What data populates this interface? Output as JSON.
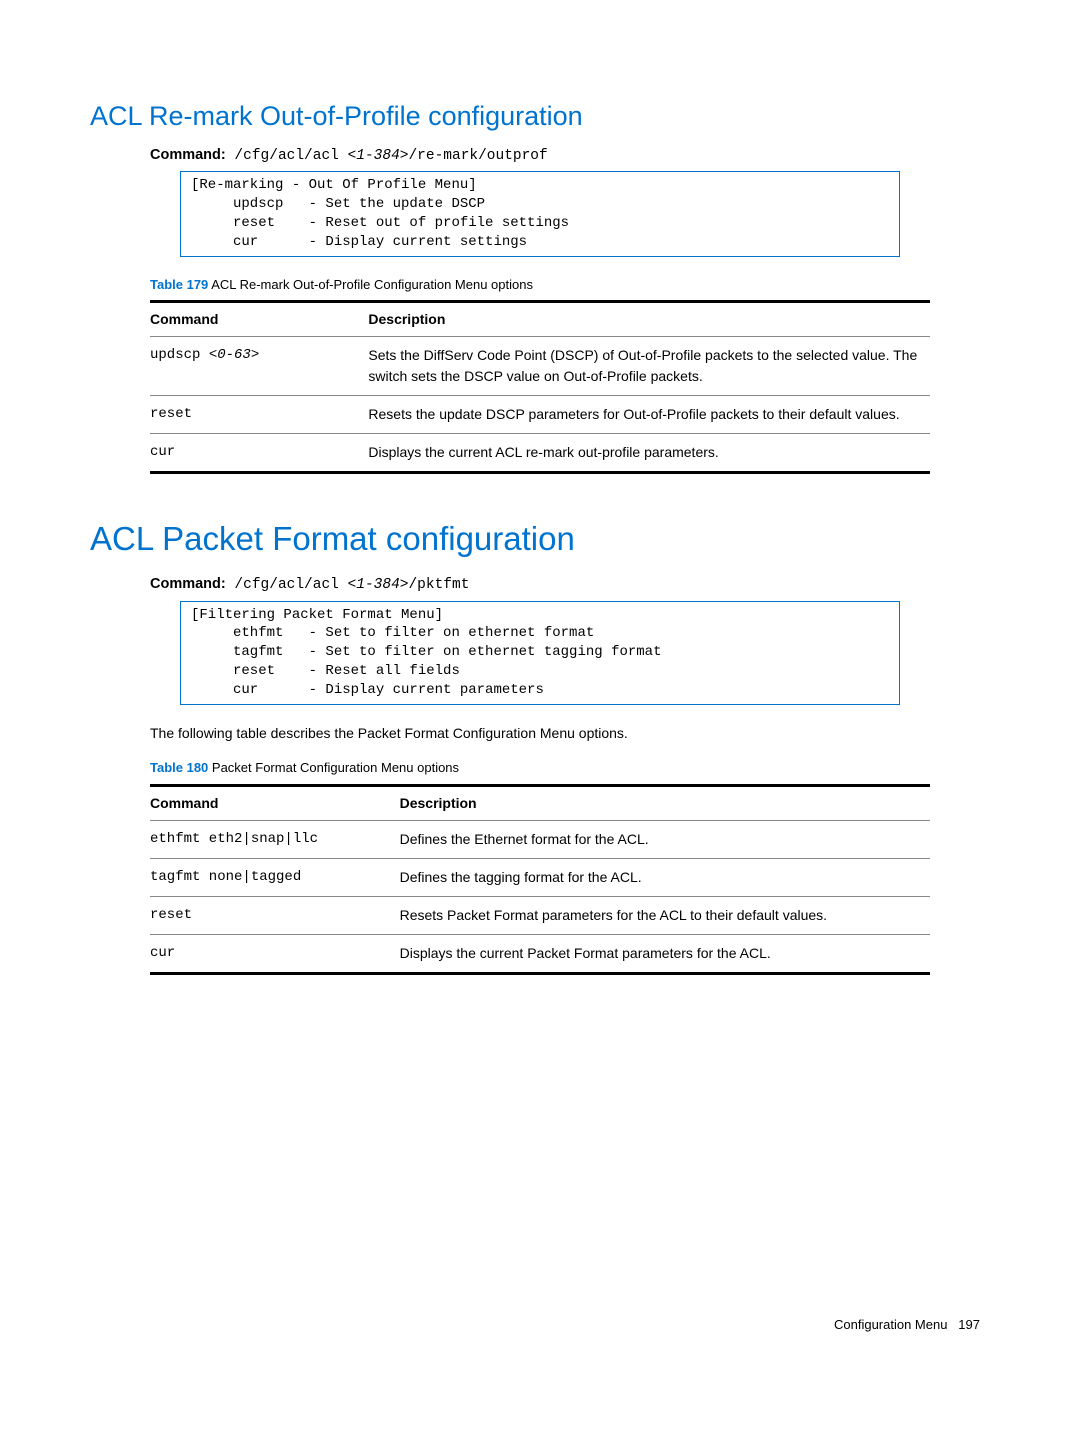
{
  "section1": {
    "heading": "ACL Re-mark Out-of-Profile configuration",
    "command_label": "Command:",
    "command_prefix": " /cfg/acl/acl ",
    "command_arg": "<1-384>",
    "command_suffix": "/re-mark/outprof",
    "code": "[Re-marking - Out Of Profile Menu]\n     updscp   - Set the update DSCP\n     reset    - Reset out of profile settings\n     cur      - Display current settings",
    "table_label": "Table 179",
    "table_caption": "  ACL Re-mark Out-of-Profile Configuration Menu options",
    "th1": "Command",
    "th2": "Description",
    "rows": [
      {
        "cmd_pre": "updscp ",
        "cmd_arg": "<0-63>",
        "desc": "Sets the DiffServ Code Point (DSCP) of Out-of-Profile packets to the selected value. The switch sets the DSCP value on Out-of-Profile packets."
      },
      {
        "cmd_pre": "reset",
        "cmd_arg": "",
        "desc": "Resets the update DSCP parameters for Out-of-Profile packets to their default values."
      },
      {
        "cmd_pre": "cur",
        "cmd_arg": "",
        "desc": "Displays the current ACL re-mark out-profile parameters."
      }
    ]
  },
  "section2": {
    "heading": "ACL Packet Format configuration",
    "command_label": "Command:",
    "command_prefix": " /cfg/acl/acl ",
    "command_arg": "<1-384>",
    "command_suffix": "/pktfmt",
    "code": "[Filtering Packet Format Menu]\n     ethfmt   - Set to filter on ethernet format\n     tagfmt   - Set to filter on ethernet tagging format\n     reset    - Reset all fields\n     cur      - Display current parameters",
    "intro": "The following table describes the Packet Format Configuration Menu options.",
    "table_label": "Table 180",
    "table_caption": "  Packet Format Configuration Menu options",
    "th1": "Command",
    "th2": "Description",
    "rows": [
      {
        "cmd": "ethfmt eth2|snap|llc",
        "desc": "Defines the Ethernet format for the ACL."
      },
      {
        "cmd": "tagfmt none|tagged",
        "desc": "Defines the tagging format for the ACL."
      },
      {
        "cmd": "reset",
        "desc": "Resets Packet Format parameters for the ACL to their default values."
      },
      {
        "cmd": "cur",
        "desc": "Displays the current Packet Format parameters for the ACL."
      }
    ]
  },
  "footer": {
    "label": "Configuration Menu",
    "page": "197"
  }
}
